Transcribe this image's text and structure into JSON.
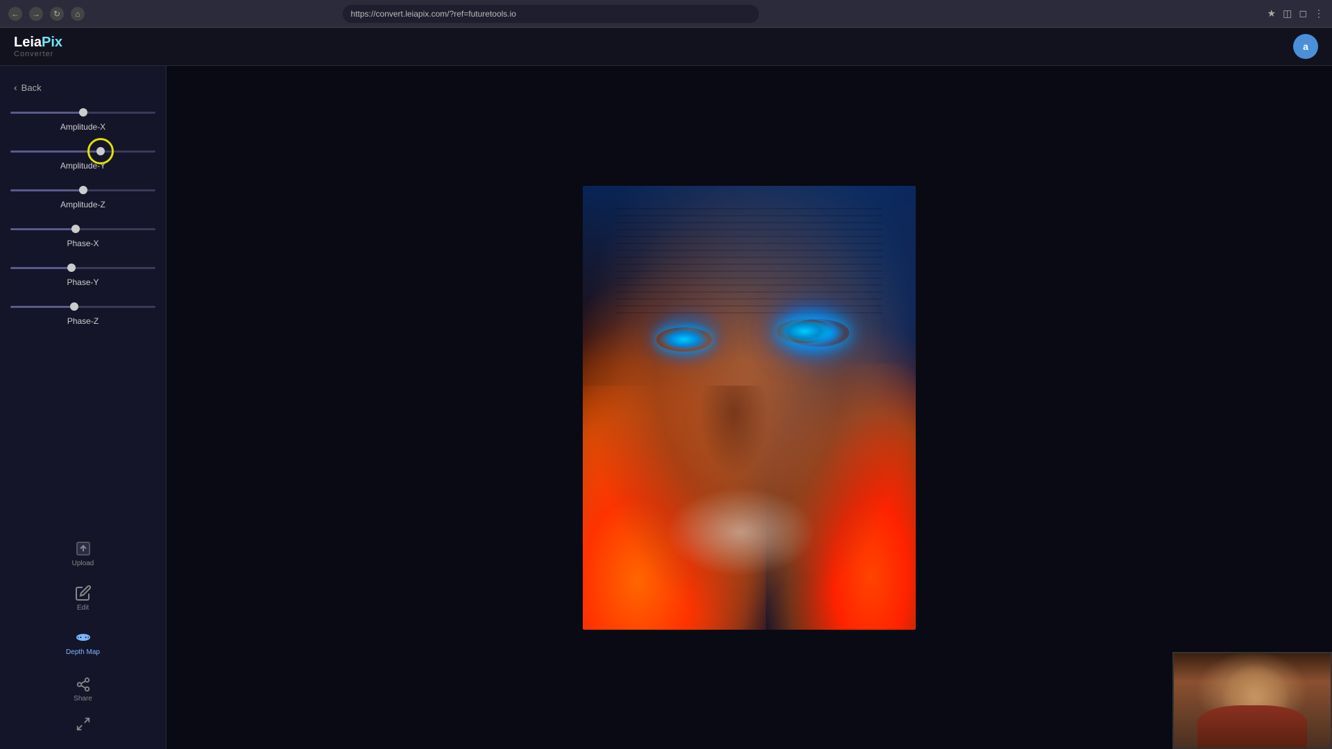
{
  "browser": {
    "url": "https://convert.leiapix.com/?ref=futuretools.io",
    "nav_back": "←",
    "nav_forward": "→",
    "nav_refresh": "↻",
    "nav_home": "⌂"
  },
  "app": {
    "logo_leia": "Leia",
    "logo_pix": "Pix",
    "logo_subtitle": "Converter",
    "user_initial": "a"
  },
  "sidebar": {
    "back_label": "Back",
    "sliders": [
      {
        "id": "amplitude-x",
        "label": "Amplitude-X",
        "value": 50,
        "fill_pct": 50,
        "thumb_pct": 50,
        "active": false
      },
      {
        "id": "amplitude-y",
        "label": "Amplitude-Y",
        "value": 62,
        "fill_pct": 62,
        "thumb_pct": 62,
        "active": true
      },
      {
        "id": "amplitude-z",
        "label": "Amplitude-Z",
        "value": 50,
        "fill_pct": 50,
        "thumb_pct": 50,
        "active": false
      },
      {
        "id": "phase-x",
        "label": "Phase-X",
        "value": 45,
        "fill_pct": 45,
        "thumb_pct": 45,
        "active": false
      },
      {
        "id": "phase-y",
        "label": "Phase-Y",
        "value": 42,
        "fill_pct": 42,
        "thumb_pct": 42,
        "active": false
      },
      {
        "id": "phase-z",
        "label": "Phase-Z",
        "value": 44,
        "fill_pct": 44,
        "thumb_pct": 44,
        "active": false
      }
    ],
    "icons": [
      {
        "id": "upload",
        "label": "Upload",
        "icon": "upload"
      },
      {
        "id": "edit",
        "label": "Edit",
        "icon": "edit",
        "active": false
      },
      {
        "id": "depth-map",
        "label": "Depth Map",
        "icon": "depth",
        "active": true
      }
    ],
    "share_label": "Share",
    "fullscreen_label": "⛶"
  }
}
